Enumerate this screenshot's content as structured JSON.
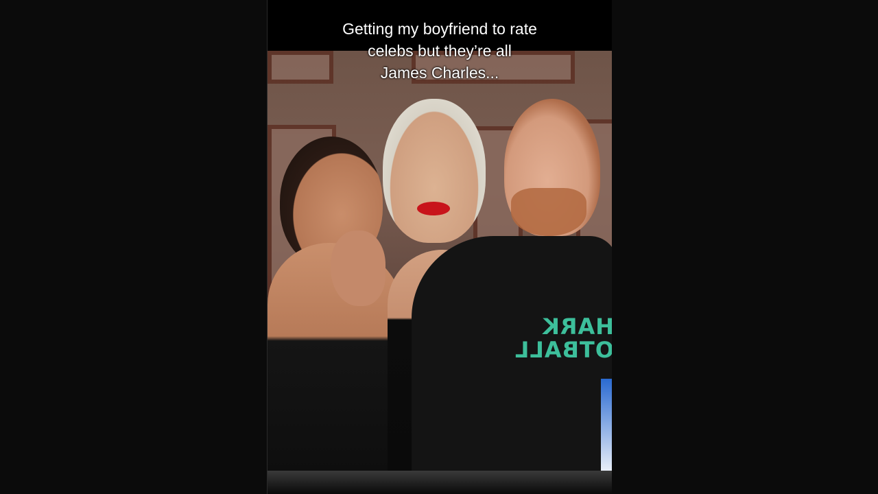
{
  "video": {
    "caption_lines": [
      "Getting my boyfriend to rate",
      "celebs but they’re all",
      "James Charles..."
    ],
    "shirt_print": [
      "HARK",
      "OTBALL"
    ]
  },
  "colors": {
    "page_background": "#0b0b0b",
    "caption_text": "#ffffff",
    "shirt_print": "#3dbf9b",
    "lipstick": "#c8141b"
  }
}
